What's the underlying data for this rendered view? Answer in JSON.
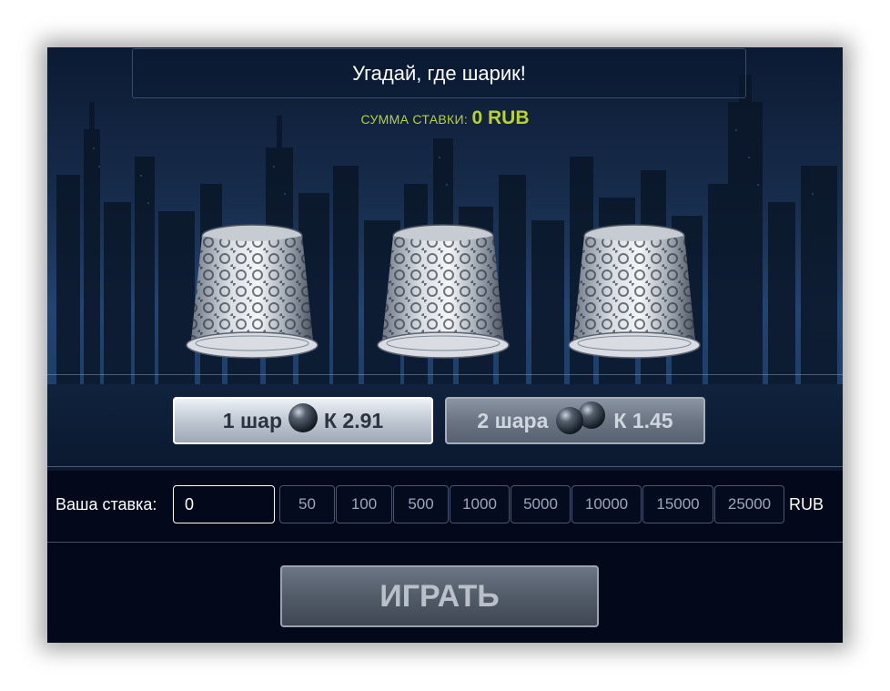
{
  "game": {
    "title": "Угадай, где шарик!",
    "stake_sum_label": "СУММА СТАВКИ:",
    "stake_sum_value": "0 RUB",
    "accent_color": "#b9d22d",
    "thimbles": [
      {
        "name": "thimble-1"
      },
      {
        "name": "thimble-2"
      },
      {
        "name": "thimble-3"
      }
    ],
    "modes": [
      {
        "label": "1 шар",
        "coef": "К 2.91",
        "balls": 1,
        "active": true
      },
      {
        "label": "2 шара",
        "coef": "К 1.45",
        "balls": 2,
        "active": false
      }
    ]
  },
  "bet": {
    "label": "Ваша ставка:",
    "value": "0",
    "chips": [
      "50",
      "100",
      "500",
      "1000",
      "5000",
      "10000",
      "15000",
      "25000"
    ],
    "currency": "RUB"
  },
  "play": {
    "label": "ИГРАТЬ"
  }
}
